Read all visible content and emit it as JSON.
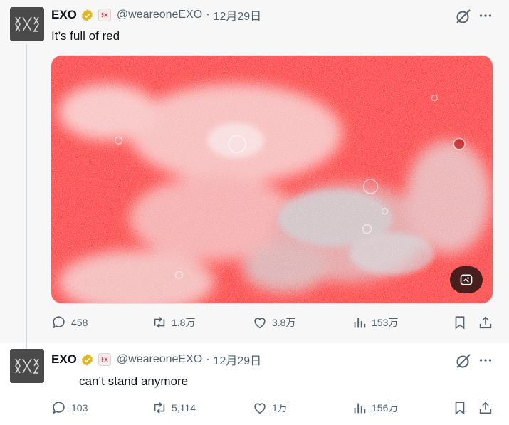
{
  "tweets": [
    {
      "name": "EXO",
      "handle": "@weareoneEXO",
      "separator": "·",
      "date": "12月29日",
      "text": "It’s full of red",
      "stats": {
        "replies": "458",
        "retweets": "1.8万",
        "likes": "3.8万",
        "views": "153万"
      }
    },
    {
      "name": "EXO",
      "handle": "@weareoneEXO",
      "separator": "·",
      "date": "12月29日",
      "text": "can’t stand anymore",
      "stats": {
        "replies": "103",
        "retweets": "5,114",
        "likes": "1万",
        "views": "156万"
      }
    }
  ],
  "colors": {
    "verified": "#e2b719",
    "text_secondary": "#536471",
    "moon_red": "#ff1a1a",
    "thread_line": "#cfd9de"
  },
  "icons": [
    "avatar-logo",
    "verified-badge-icon",
    "affiliate-badge-icon",
    "grok-icon",
    "more-icon",
    "reply-icon",
    "retweet-icon",
    "like-icon",
    "views-icon",
    "bookmark-icon",
    "share-icon",
    "alt-text-icon"
  ]
}
